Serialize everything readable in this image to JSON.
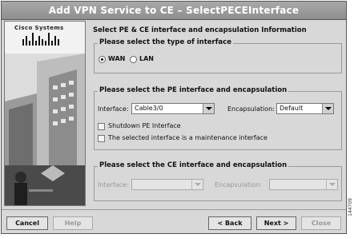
{
  "window": {
    "title": "Add VPN Service to CE – SelectPECEInterface"
  },
  "branding": {
    "logo_text": "Cisco Systems"
  },
  "main": {
    "heading": "Select PE & CE interface and encapsulation Information"
  },
  "interface_type": {
    "title": "Please select the type of interface",
    "options": [
      {
        "label": "WAN",
        "selected": true
      },
      {
        "label": "LAN",
        "selected": false
      }
    ]
  },
  "pe": {
    "title": "Please select the PE interface and encapsulation",
    "interface_label": "Interface:",
    "interface_value": "Cable3/0",
    "encapsulation_label": "Encapsulation:",
    "encapsulation_value": "Default",
    "shutdown_label": "Shutdown PE Interface",
    "maintenance_label": "The selected interface is a maintenance interface"
  },
  "ce": {
    "title": "Please select the CE interface and encapsulation",
    "interface_label": "Interface:",
    "interface_value": "",
    "encapsulation_label": "Encapsulation:",
    "encapsulation_value": ""
  },
  "buttons": {
    "cancel": "Cancel",
    "help": "Help",
    "back": "< Back",
    "next": "Next >",
    "close": "Close"
  },
  "figure_code": "144709"
}
